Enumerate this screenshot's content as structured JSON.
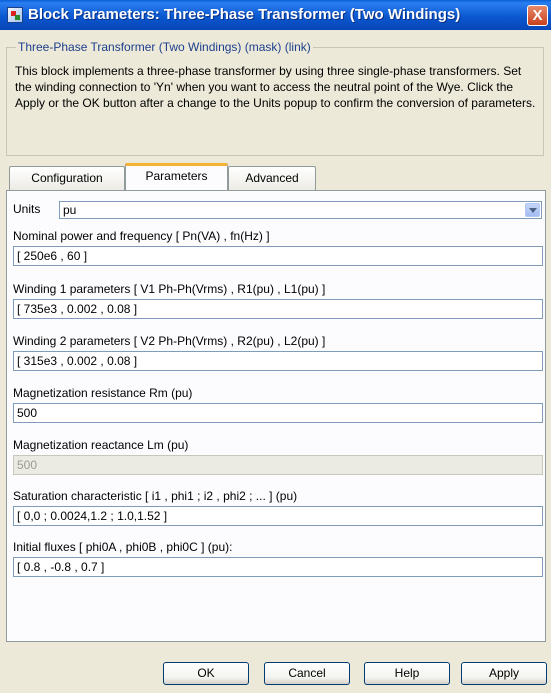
{
  "window": {
    "title": "Block Parameters: Three-Phase Transformer (Two Windings)",
    "close_glyph": "X"
  },
  "mask": {
    "legend": "Three-Phase Transformer (Two Windings) (mask) (link)",
    "description": "This block implements a three-phase transformer by using three single-phase transformers. Set the winding connection to 'Yn' when you want to access the neutral point of the Wye. Click the Apply or the OK button after a change to the Units popup to confirm the conversion of parameters."
  },
  "tabs": [
    {
      "label": "Configuration",
      "active": false
    },
    {
      "label": "Parameters",
      "active": true
    },
    {
      "label": "Advanced",
      "active": false
    }
  ],
  "units": {
    "label": "Units",
    "value": "pu"
  },
  "params": [
    {
      "label": "Nominal power and frequency [ Pn(VA) , fn(Hz) ]",
      "value": "[ 250e6 , 60 ]",
      "enabled": true
    },
    {
      "label": "Winding 1 parameters [ V1 Ph-Ph(Vrms) , R1(pu) , L1(pu) ]",
      "value": "[ 735e3 , 0.002 , 0.08 ]",
      "enabled": true
    },
    {
      "label": "Winding 2 parameters [ V2 Ph-Ph(Vrms) , R2(pu) , L2(pu) ]",
      "value": "[ 315e3 , 0.002 , 0.08 ]",
      "enabled": true
    },
    {
      "label": "Magnetization resistance Rm (pu)",
      "value": "500",
      "enabled": true
    },
    {
      "label": "Magnetization reactance Lm (pu)",
      "value": "500",
      "enabled": false
    },
    {
      "label": "Saturation characteristic [ i1 , phi1 ; i2 , phi2 ; ... ] (pu)",
      "value": "[ 0,0 ; 0.0024,1.2 ; 1.0,1.52 ]",
      "enabled": true
    },
    {
      "label": "Initial fluxes [ phi0A , phi0B , phi0C ] (pu):",
      "value": "[ 0.8 , -0.8 , 0.7 ]",
      "enabled": true
    }
  ],
  "buttons": {
    "ok": "OK",
    "cancel": "Cancel",
    "help": "Help",
    "apply": "Apply"
  },
  "colors": {
    "titlebar": "#0a5fd8",
    "dialog_bg": "#ece9d8",
    "active_tab_accent": "#f2b234",
    "legend_text": "#1c3f8c"
  }
}
